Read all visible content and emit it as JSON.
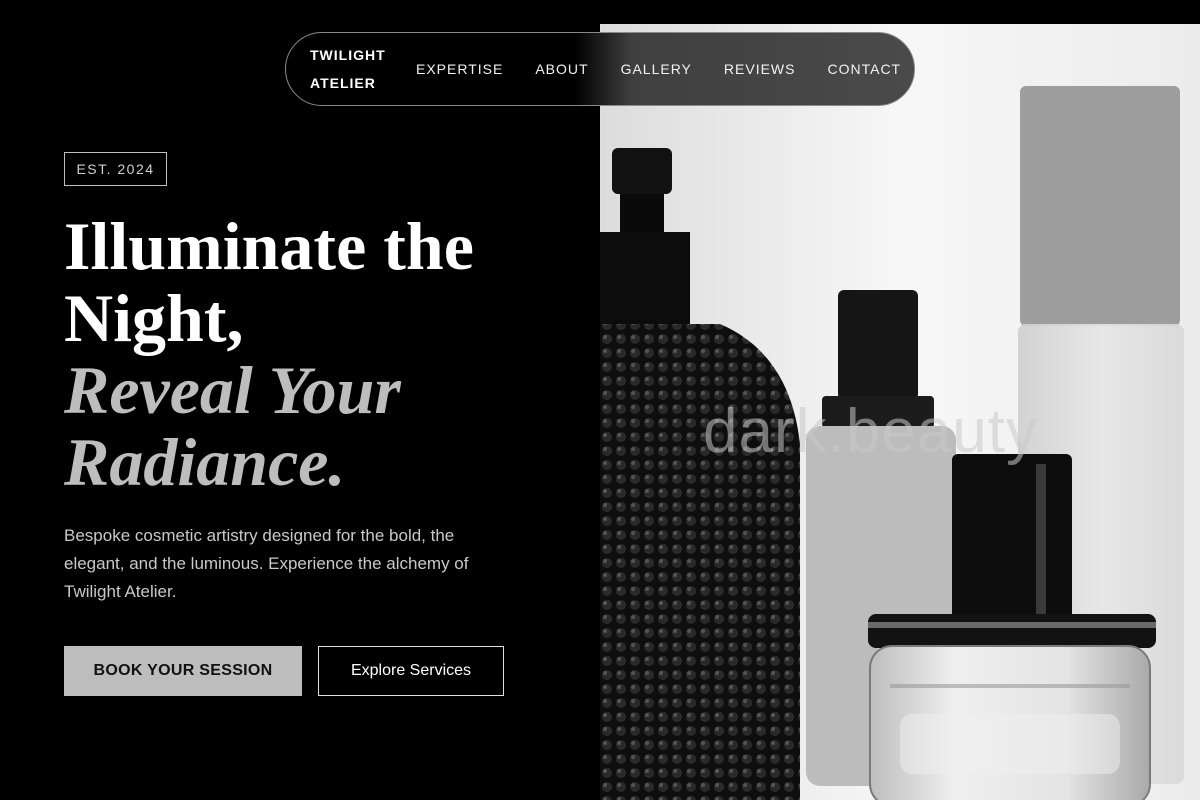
{
  "nav": {
    "brand_line1": "TWILIGHT",
    "brand_line2": "ATELIER",
    "links": [
      "EXPERTISE",
      "ABOUT",
      "GALLERY",
      "REVIEWS",
      "CONTACT"
    ]
  },
  "hero": {
    "badge": "EST. 2024",
    "headline_line1": "Illuminate the",
    "headline_line2": "Night,",
    "headline_line3": "Reveal Your",
    "headline_line4": "Radiance.",
    "description": "Bespoke cosmetic artistry designed for the bold, the elegant, and the luminous. Experience the alchemy of Twilight Atelier.",
    "primary_button": "BOOK YOUR SESSION",
    "secondary_button": "Explore Services"
  },
  "image": {
    "watermark": "dark.beauty"
  },
  "colors": {
    "background": "#000000",
    "accent_gray": "#bdbdbd",
    "text_light": "#c9c9c9"
  }
}
